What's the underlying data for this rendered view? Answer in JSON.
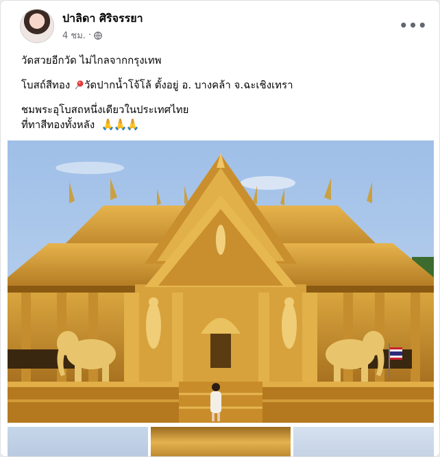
{
  "post": {
    "author": "ปาลิดา ศิริจรรยา",
    "time": "4 ชม.",
    "privacy_icon": "globe-icon",
    "more_icon": "more-options-icon",
    "text": {
      "line1": "วัดสวยอีกวัด  ไม่ไกลจากกรุงเทพ",
      "line2_prefix": "โบสถ์สีทอง ",
      "line2_suffix": "วัดปากน้ำโจ้โล้ ตั้งอยู่ อ. บางคล้า จ.ฉะเชิงเทรา",
      "line3": "ชมพระอุโบสถหนึ่งเดียวในประเทศไทย",
      "line4": "ที่ทาสีทองทั้งหลัง",
      "pray_emoji": "🙏🙏🙏"
    }
  },
  "colors": {
    "sky": "#a9c6ea",
    "gold": "#d8a33c",
    "gold_dark": "#8a5a12",
    "text_secondary": "#65676b"
  }
}
